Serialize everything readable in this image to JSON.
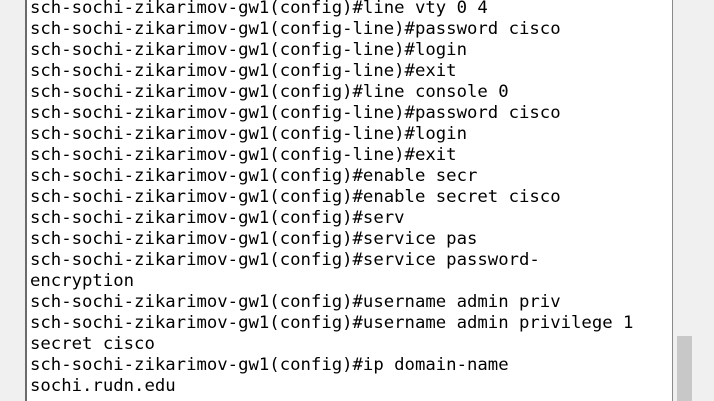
{
  "terminal": {
    "lines": [
      "sch-sochi-zikarimov-gw1(config)#line vty 0 4",
      "sch-sochi-zikarimov-gw1(config-line)#password cisco",
      "sch-sochi-zikarimov-gw1(config-line)#login",
      "sch-sochi-zikarimov-gw1(config-line)#exit",
      "sch-sochi-zikarimov-gw1(config)#line console 0",
      "sch-sochi-zikarimov-gw1(config-line)#password cisco",
      "sch-sochi-zikarimov-gw1(config-line)#login",
      "sch-sochi-zikarimov-gw1(config-line)#exit",
      "sch-sochi-zikarimov-gw1(config)#enable secr",
      "sch-sochi-zikarimov-gw1(config)#enable secret cisco",
      "sch-sochi-zikarimov-gw1(config)#serv",
      "sch-sochi-zikarimov-gw1(config)#service pas",
      "sch-sochi-zikarimov-gw1(config)#service password-",
      "encryption",
      "sch-sochi-zikarimov-gw1(config)#username admin priv",
      "sch-sochi-zikarimov-gw1(config)#username admin privilege 1",
      "secret cisco",
      "sch-sochi-zikarimov-gw1(config)#ip domain-name",
      "sochi.rudn.edu"
    ]
  },
  "scrollbar": {
    "position_fraction": 1.0
  }
}
